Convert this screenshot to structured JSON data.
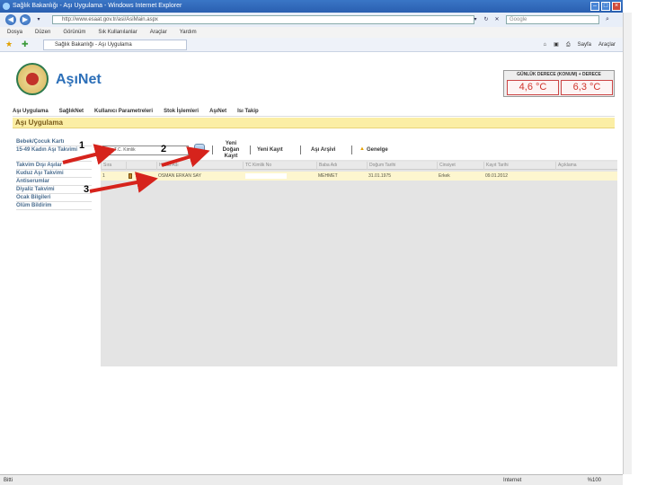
{
  "browser": {
    "window_title": "Sağlık Bakanlığı - Aşı Uygulama - Windows Internet Explorer",
    "address": "http://www.esaat.gov.tr/asi/AsiMain.aspx",
    "search_placeholder": "Google",
    "menu": [
      "Dosya",
      "Düzen",
      "Görünüm",
      "Sık Kullanılanlar",
      "Araçlar",
      "Yardım"
    ],
    "tab_label": "Sağlık Bakanlığı - Aşı Uygulama",
    "tools": {
      "page": "Sayfa",
      "tools": "Araçlar"
    }
  },
  "app": {
    "logo_text": "AşıNet",
    "weather": {
      "title": "GÜNLÜK DERECE (KONUM) + DERECE",
      "temp_1": "4,6 °C",
      "temp_2": "6,3 °C"
    },
    "menu": [
      "Aşı Uygulama",
      "SağlıkNet",
      "Kullanıcı Parametreleri",
      "Stok İşlemleri",
      "AşıNet",
      "Isı Takip"
    ],
    "section_title": "Aşı Uygulama",
    "sidebar": [
      "Bebek/Çocuk Kartı",
      "15-49 Kadın Aşı Takvimi",
      "Takvim Dışı Aşılar",
      "Kuduz Aşı Takvimi",
      "Antiserumlar",
      "Diyaliz Takvimi",
      "Ocak Bilgileri",
      "Ölüm Bildirim"
    ],
    "toolbar": {
      "search_value": "T.C. Kimlik",
      "new_baby_line1": "Yeni",
      "new_baby_line2": "Doğan",
      "new_baby_line3": "Kayıt",
      "new_record": "Yeni Kayıt",
      "vaccine_archive": "Aşı Arşivi",
      "circular": "Genelge"
    },
    "grid": {
      "headers": [
        "Sıra",
        "",
        "Hasta Adı",
        "TC Kimlik No",
        "Baba Adı",
        "Doğum Tarihi",
        "Cinsiyet",
        "Kayıt Tarihi",
        "Açıklama"
      ],
      "row": {
        "sira": "1",
        "hasta_adi": "OSMAN ERKAN SAY",
        "baba_adi": "MEHMET",
        "dogum_tarihi": "31.01.1975",
        "cinsiyet": "Erkek",
        "kayit_tarihi": "09.01.2012"
      }
    }
  },
  "annotations": {
    "n1": "1",
    "n2": "2",
    "n3": "3"
  },
  "status": {
    "left": "Bitti",
    "zone": "Internet",
    "zoom": "%100"
  },
  "colors": {
    "arrow": "#d6231c",
    "accent": "#2c6fb8",
    "section": "#fbeea5"
  }
}
